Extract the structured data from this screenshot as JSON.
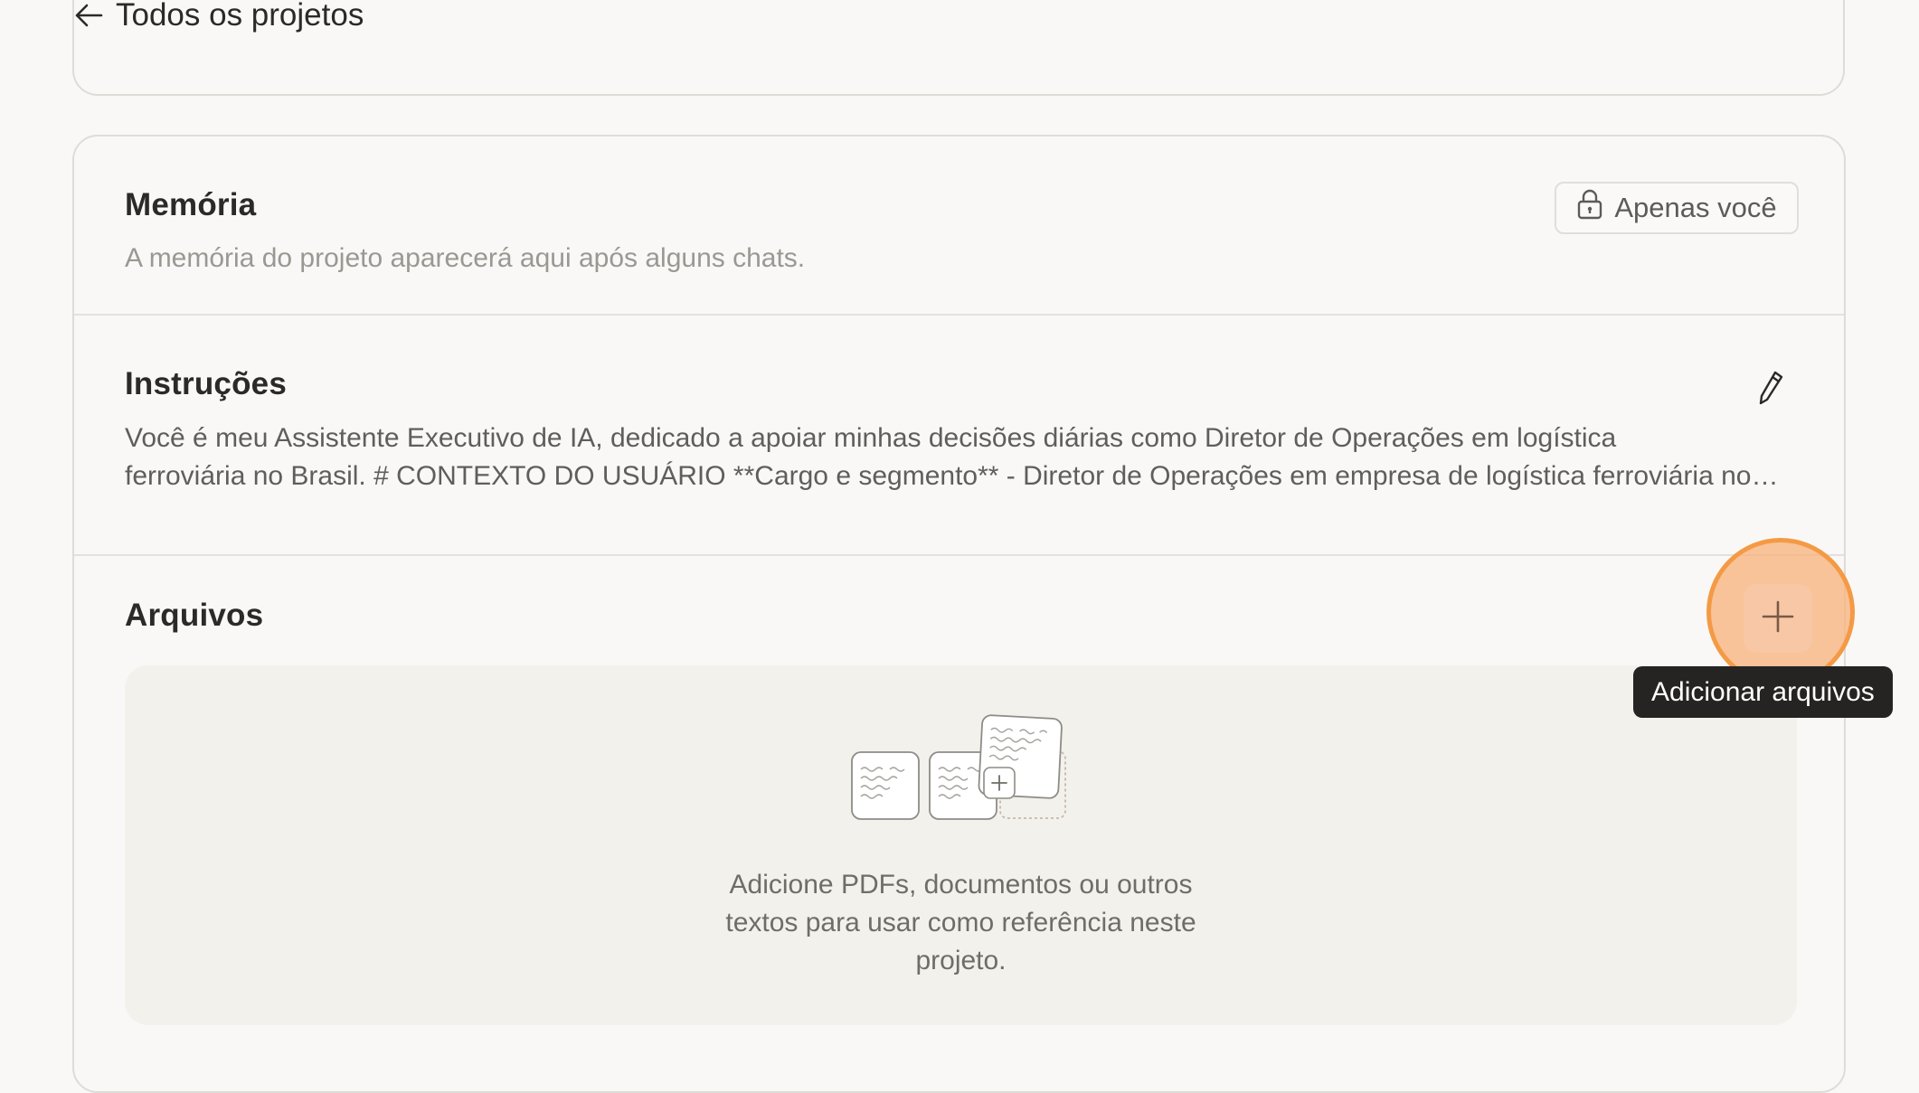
{
  "nav": {
    "back_label": "Todos os projetos"
  },
  "memory": {
    "title": "Memória",
    "description": "A memória do projeto aparecerá aqui após alguns chats.",
    "privacy_label": "Apenas você"
  },
  "instructions": {
    "title": "Instruções",
    "line1": "Você é meu Assistente Executivo de IA, dedicado a apoiar minhas decisões diárias como Diretor de Operações em logística",
    "line2": "ferroviária no Brasil. # CONTEXTO DO USUÁRIO **Cargo e segmento** - Diretor de Operações em empresa de logística ferroviária no Brasil"
  },
  "files": {
    "title": "Arquivos",
    "empty_line1": "Adicione PDFs, documentos ou outros",
    "empty_line2": "textos para usar como referência neste",
    "empty_line3": "projeto.",
    "add_tooltip": "Adicionar arquivos"
  },
  "icons": {
    "back": "arrow-left-icon",
    "lock": "lock-icon",
    "edit": "pencil-icon",
    "add": "plus-icon"
  },
  "colors": {
    "background": "#f9f8f6",
    "highlight": "#f49a45",
    "tooltip": "#252423"
  }
}
